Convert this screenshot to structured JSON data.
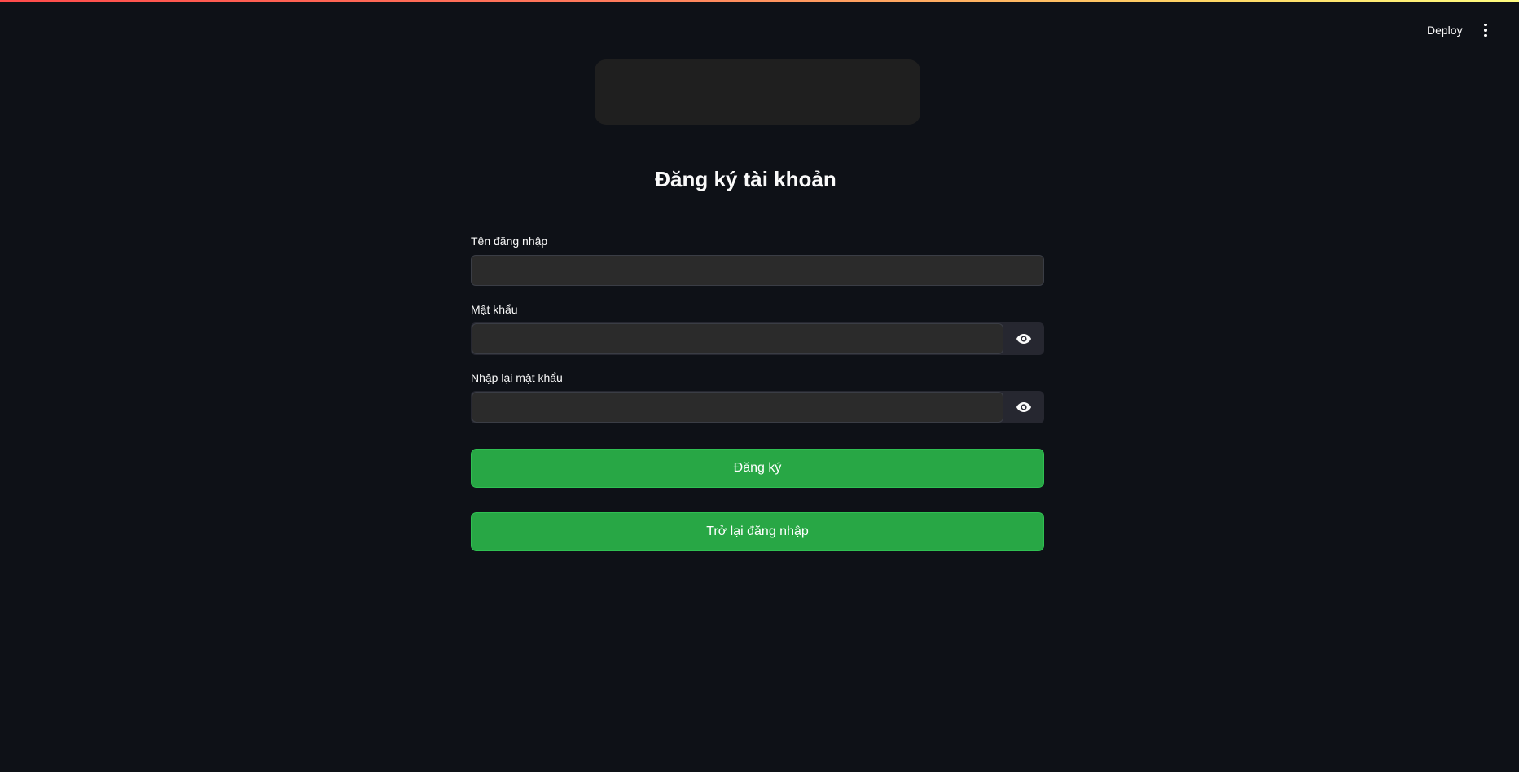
{
  "header": {
    "deploy_label": "Deploy",
    "menu_icon": "vertical-ellipsis-icon"
  },
  "form": {
    "title": "Đăng ký tài khoản",
    "username": {
      "label": "Tên đăng nhập",
      "value": "",
      "placeholder": ""
    },
    "password": {
      "label": "Mật khẩu",
      "value": "",
      "placeholder": "",
      "toggle_icon": "eye-icon"
    },
    "confirm_password": {
      "label": "Nhập lại mật khẩu",
      "value": "",
      "placeholder": "",
      "toggle_icon": "eye-icon"
    },
    "register_label": "Đăng ký",
    "back_to_login_label": "Trở lại đăng nhập"
  },
  "colors": {
    "background": "#0e1117",
    "input_background": "#2b2b2b",
    "button_green": "#28a745",
    "text": "#fafafa"
  }
}
